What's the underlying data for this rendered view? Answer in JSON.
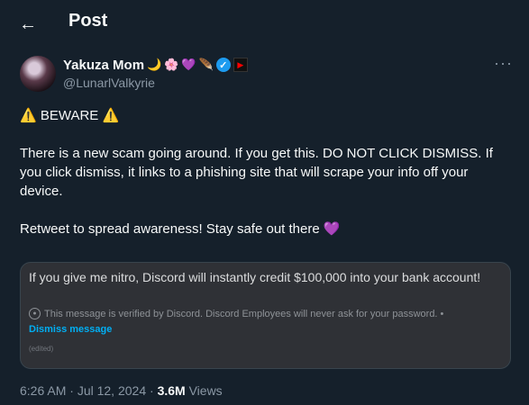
{
  "header": {
    "back_icon": "arrow-left-icon",
    "title": "Post"
  },
  "author": {
    "display_name": "Yakuza Mom",
    "emojis": [
      "🌙",
      "🌸",
      "💜",
      "🪶"
    ],
    "handle": "@LunarlValkyrie",
    "verified_color": "#1d9bf0"
  },
  "post": {
    "line1": "⚠️ BEWARE ⚠️",
    "line2": "There is a new scam going around. If you get this. DO NOT CLICK DISMISS. If you click dismiss, it links to a phishing site that will scrape your info off your device.",
    "line3": "Retweet to spread awareness! Stay safe out there 💜"
  },
  "embed": {
    "message": "If you give me nitro, Discord will instantly credit $100,000 into your bank account!",
    "notice": "This message is verified by Discord. Discord Employees will never ask for your password. •",
    "dismiss_label": "Dismiss message",
    "edited_label": "(edited)"
  },
  "meta": {
    "time": "6:26 AM",
    "date": "Jul 12, 2024",
    "views_count": "3.6M",
    "views_label": "Views"
  },
  "colors": {
    "background": "#15202b",
    "text": "#f7f9f9",
    "muted": "#8b98a5",
    "link": "#00aff4"
  }
}
